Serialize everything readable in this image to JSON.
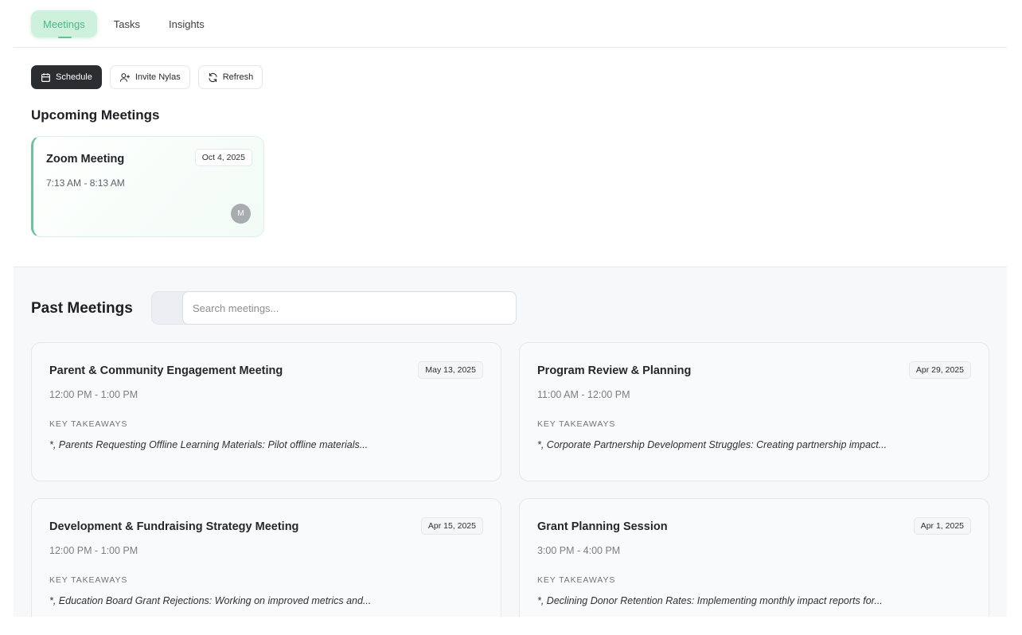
{
  "tabs": [
    {
      "label": "Meetings",
      "active": true
    },
    {
      "label": "Tasks",
      "active": false
    },
    {
      "label": "Insights",
      "active": false
    }
  ],
  "toolbar": {
    "schedule_label": "Schedule",
    "invite_label": "Invite Nylas",
    "refresh_label": "Refresh"
  },
  "upcoming": {
    "title": "Upcoming Meetings",
    "meetings": [
      {
        "title": "Zoom Meeting",
        "date": "Oct 4, 2025",
        "time": "7:13 AM - 8:13 AM",
        "avatar_initial": "M"
      }
    ]
  },
  "past": {
    "title": "Past Meetings",
    "search_placeholder": "Search meetings...",
    "key_takeaways_label": "KEY TAKEAWAYS",
    "meetings": [
      {
        "title": "Parent & Community Engagement Meeting",
        "date": "May 13, 2025",
        "time": "12:00 PM - 1:00 PM",
        "takeaway": "*, Parents Requesting Offline Learning Materials: Pilot offline materials..."
      },
      {
        "title": "Program Review & Planning",
        "date": "Apr 29, 2025",
        "time": "11:00 AM - 12:00 PM",
        "takeaway": "*, Corporate Partnership Development Struggles: Creating partnership impact..."
      },
      {
        "title": "Development & Fundraising Strategy Meeting",
        "date": "Apr 15, 2025",
        "time": "12:00 PM - 1:00 PM",
        "takeaway": "*, Education Board Grant Rejections: Working on improved metrics and..."
      },
      {
        "title": "Grant Planning Session",
        "date": "Apr 1, 2025",
        "time": "3:00 PM - 4:00 PM",
        "takeaway": "*, Declining Donor Retention Rates: Implementing monthly impact reports for..."
      }
    ]
  },
  "colors": {
    "accent_green": "#5ac790",
    "tab_active_bg": "#cdf1dc",
    "primary_button": "#2b2d30",
    "upcoming_border": "#6cc39a"
  },
  "icons": [
    "calendar-icon",
    "user-plus-icon",
    "refresh-icon"
  ]
}
